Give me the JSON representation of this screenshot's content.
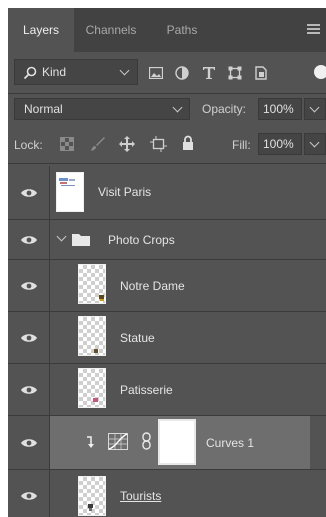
{
  "tabs": [
    {
      "label": "Layers",
      "active": true
    },
    {
      "label": "Channels",
      "active": false
    },
    {
      "label": "Paths",
      "active": false
    }
  ],
  "filter": {
    "search_icon": "search-icon",
    "kind_label": "Kind"
  },
  "blend": {
    "mode": "Normal",
    "opacity_label": "Opacity:",
    "opacity_value": "100%"
  },
  "lock": {
    "label": "Lock:",
    "fill_label": "Fill:",
    "fill_value": "100%"
  },
  "layers": [
    {
      "name": "Visit Paris",
      "type": "image",
      "visible": true
    },
    {
      "name": "Photo Crops",
      "type": "group",
      "visible": true,
      "expanded": true
    },
    {
      "name": "Notre Dame",
      "type": "image",
      "visible": true,
      "indent": true
    },
    {
      "name": "Statue",
      "type": "image",
      "visible": true,
      "indent": true
    },
    {
      "name": "Patisserie",
      "type": "image",
      "visible": true,
      "indent": true
    },
    {
      "name": "Curves 1",
      "type": "adjustment",
      "visible": true,
      "indent": true,
      "selected": true,
      "clipped": true
    },
    {
      "name": "Tourists",
      "type": "image",
      "visible": true,
      "indent": true
    }
  ],
  "colors": {
    "panel": "#535353",
    "tabbar": "#424242",
    "selected_row": "#6e6e6e"
  }
}
